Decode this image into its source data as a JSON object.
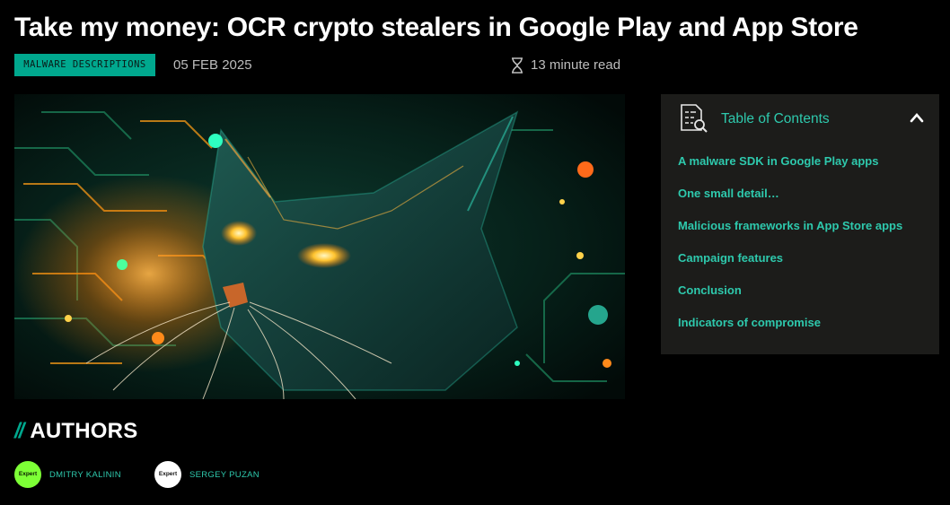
{
  "article": {
    "title": "Take my money: OCR crypto stealers in Google Play and App Store",
    "category": "MALWARE DESCRIPTIONS",
    "date": "05 FEB 2025",
    "read_time": "13 minute read",
    "hero_icon": "cat-cyber-illustration"
  },
  "toc": {
    "title": "Table of Contents",
    "icon": "document-search-icon",
    "toggle_icon": "chevron-up-icon",
    "items": [
      {
        "label": "A malware SDK in Google Play apps"
      },
      {
        "label": "One small detail…"
      },
      {
        "label": "Malicious frameworks in App Store apps"
      },
      {
        "label": "Campaign features"
      },
      {
        "label": "Conclusion"
      },
      {
        "label": "Indicators of compromise"
      }
    ]
  },
  "authors": {
    "slashes": "//",
    "heading": "AUTHORS",
    "list": [
      {
        "badge": "Expert",
        "name": "DMITRY KALININ",
        "badge_color": "#7dff36"
      },
      {
        "badge": "Expert",
        "name": "SERGEY PUZAN",
        "badge_color": "#ffffff"
      }
    ]
  },
  "colors": {
    "accent": "#00a88e",
    "link": "#2ec9ad",
    "panel": "#1c1c1a"
  }
}
